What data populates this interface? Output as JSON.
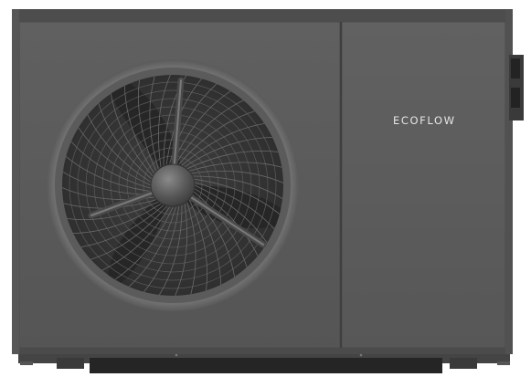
{
  "brand_label": "ECOFLOW",
  "colors": {
    "body": "#5d5d5d",
    "body_dark": "#4a4a4a",
    "fan_ring": "#6a6a6a",
    "fan_grill": "#3b3b3b",
    "fan_blade": "#2a2a2a",
    "hub": "#575757",
    "base": "#2f2f2f",
    "feet": "#3a3a3a",
    "logo": "#e6e6e6"
  },
  "icons": [
    "fan-grille-icon",
    "fan-hub-icon",
    "pipe-connector-icon"
  ]
}
